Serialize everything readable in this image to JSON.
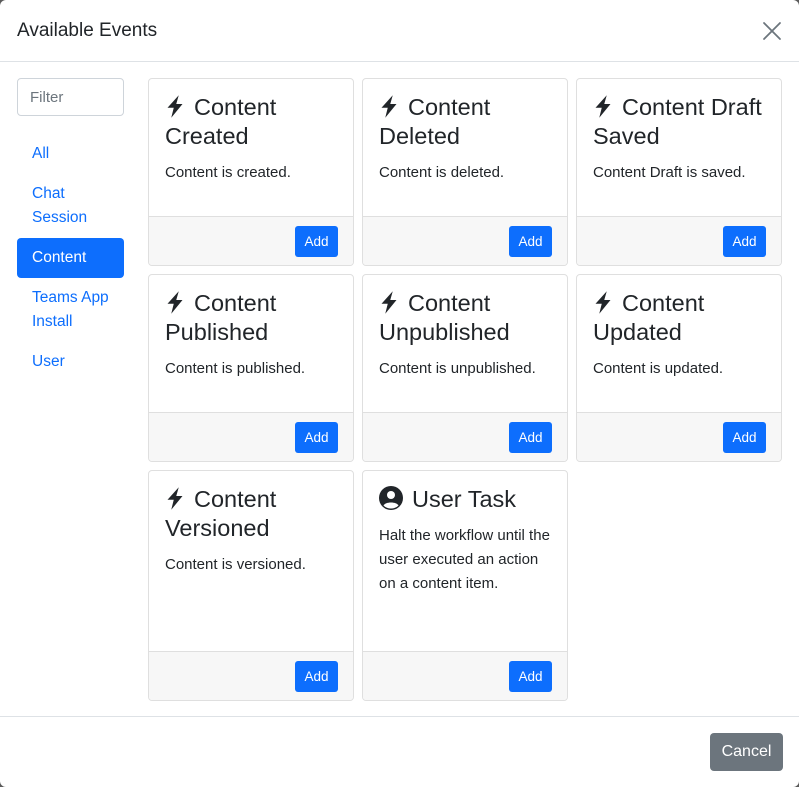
{
  "modal": {
    "title": "Available Events",
    "close_icon": "close-icon"
  },
  "sidebar": {
    "filter_placeholder": "Filter",
    "items": [
      {
        "label": "All",
        "active": false
      },
      {
        "label": "Chat Session",
        "active": false
      },
      {
        "label": "Content",
        "active": true
      },
      {
        "label": "Teams App Install",
        "active": false
      },
      {
        "label": "User",
        "active": false
      }
    ]
  },
  "events": [
    {
      "icon": "lightning-icon",
      "title": "Content Created",
      "description": "Content is created.",
      "button": "Add"
    },
    {
      "icon": "lightning-icon",
      "title": "Content Deleted",
      "description": "Content is deleted.",
      "button": "Add"
    },
    {
      "icon": "lightning-icon",
      "title": "Content Draft Saved",
      "description": "Content Draft is saved.",
      "button": "Add"
    },
    {
      "icon": "lightning-icon",
      "title": "Content Published",
      "description": "Content is published.",
      "button": "Add"
    },
    {
      "icon": "lightning-icon",
      "title": "Content Unpublished",
      "description": "Content is unpublished.",
      "button": "Add"
    },
    {
      "icon": "lightning-icon",
      "title": "Content Updated",
      "description": "Content is updated.",
      "button": "Add"
    },
    {
      "icon": "lightning-icon",
      "title": "Content Versioned",
      "description": "Content is versioned.",
      "button": "Add"
    },
    {
      "icon": "user-circle-icon",
      "title": "User Task",
      "description": "Halt the workflow until the user executed an action on a content item.",
      "button": "Add"
    }
  ],
  "footer": {
    "cancel_label": "Cancel"
  },
  "colors": {
    "primary": "#0d6efd",
    "secondary": "#6c757d",
    "card_footer_bg": "#f7f7f7"
  }
}
